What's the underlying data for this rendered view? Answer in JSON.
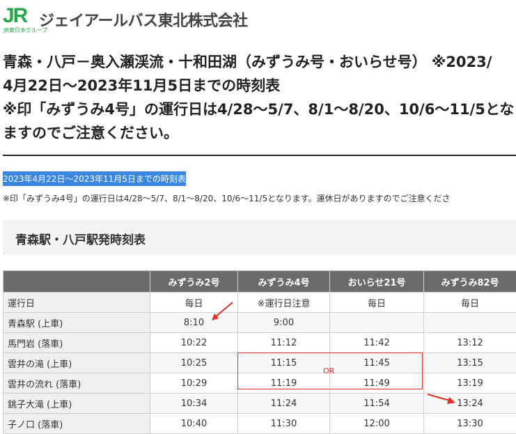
{
  "brand": {
    "logo_mark": "JR",
    "logo_sub": "JR東日本グループ",
    "name": "ジェイアールバス東北株式会社",
    "color": "#2aa64a"
  },
  "heading": {
    "lines": [
      "青森・八戸－奥入瀬渓流・十和田湖（みずうみ号・おいらせ号） ※2023/",
      "4月22日～2023年11月5日までの時刻表",
      "※印「みずうみ4号」の運行日は4/28～5/7、8/1～8/20、10/6～11/5とな",
      "ますのでご注意ください。"
    ]
  },
  "highlight": "2023年4月22日～2023年11月5日までの時刻表",
  "note": "※印「みずうみ4号」の運行日は4/28～5/7、8/1～8/20、10/6～11/5となります。運休日がありますのでご注意くださ",
  "section_title": "青森駅・八戸駅発時刻表",
  "timetable": {
    "columns": [
      "",
      "みずうみ2号",
      "みずうみ4号",
      "おいらせ21号",
      "みずうみ82号"
    ],
    "rows": [
      {
        "stop": "運行日",
        "times": [
          "毎日",
          "※運行日注意",
          "毎日",
          "毎日"
        ]
      },
      {
        "stop": "青森駅 (上車)",
        "times": [
          "8:10",
          "9:00",
          "",
          ""
        ]
      },
      {
        "stop": "馬門岩 (落車)",
        "times": [
          "10:22",
          "11:12",
          "11:42",
          "13:12"
        ]
      },
      {
        "stop": "雲井の滝 (上車)",
        "times": [
          "10:25",
          "11:15",
          "11:45",
          "13:15"
        ]
      },
      {
        "stop": "雲井の流れ (落車)",
        "times": [
          "10:29",
          "11:19",
          "11:49",
          "13:19"
        ]
      },
      {
        "stop": "銚子大滝 (上車)",
        "times": [
          "10:34",
          "11:24",
          "11:54",
          "13:24"
        ]
      },
      {
        "stop": "子ノ口 (落車)",
        "times": [
          "10:40",
          "11:30",
          "12:00",
          "13:30"
        ]
      }
    ]
  },
  "annotation": {
    "or_label": "OR",
    "color": "#e0302a"
  }
}
